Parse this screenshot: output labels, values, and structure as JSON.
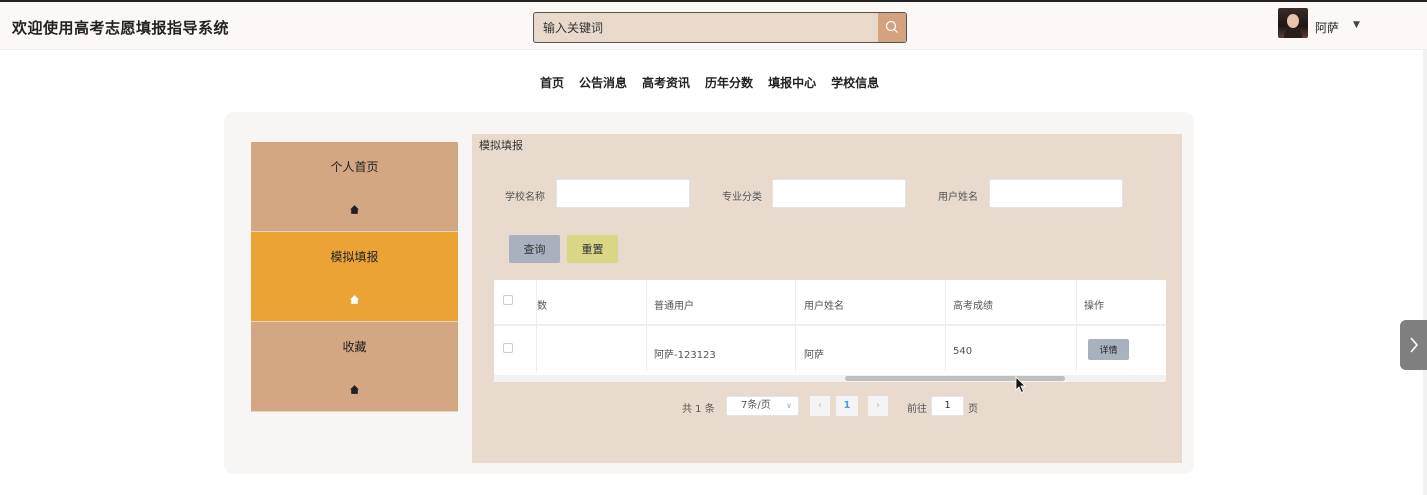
{
  "app": {
    "title": "欢迎使用高考志愿填报指导系统"
  },
  "search": {
    "placeholder": "输入关键词"
  },
  "user": {
    "name": "阿萨"
  },
  "nav": {
    "items": [
      "首页",
      "公告消息",
      "高考资讯",
      "历年分数",
      "填报中心",
      "学校信息"
    ]
  },
  "sidebar": {
    "items": [
      {
        "label": "个人首页",
        "active": false
      },
      {
        "label": "模拟填报",
        "active": true
      },
      {
        "label": "收藏",
        "active": false
      }
    ]
  },
  "main": {
    "title": "模拟填报",
    "filters": {
      "school_label": "学校名称",
      "major_label": "专业分类",
      "username_label": "用户姓名"
    },
    "buttons": {
      "query": "查询",
      "reset": "重置",
      "detail": "详情"
    },
    "table": {
      "columns": [
        "数",
        "普通用户",
        "用户姓名",
        "高考成绩",
        "操作"
      ],
      "rows": [
        {
          "cells": [
            "",
            "阿萨-123123",
            "阿萨",
            "540"
          ]
        }
      ]
    },
    "pagination": {
      "total": "共 1 条",
      "page_size": "7条/页",
      "current": "1",
      "goto_label": "前往",
      "goto_value": "1",
      "page_unit": "页"
    }
  },
  "colors": {
    "sidebar": "#d4a783",
    "sidebar_active": "#eca336",
    "content_bg": "#e8dbcd",
    "query_btn": "#a9b1bf",
    "reset_btn": "#d9d685",
    "search_btn": "#d4a27e"
  }
}
